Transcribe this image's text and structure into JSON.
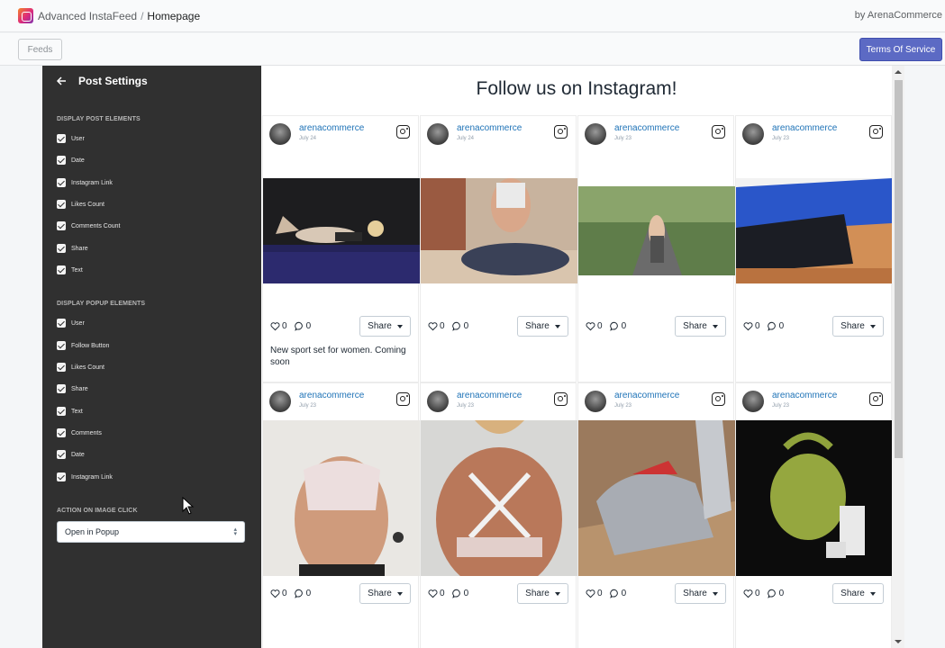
{
  "header": {
    "app_name": "Advanced InstaFeed",
    "separator": "/",
    "page": "Homepage",
    "byline": "by ArenaCommerce"
  },
  "toolbar": {
    "feeds_label": "Feeds",
    "tos_label": "Terms Of Service"
  },
  "sidebar": {
    "title": "Post Settings",
    "post_section_title": "DISPLAY POST ELEMENTS",
    "post_elements": [
      "User",
      "Date",
      "Instagram Link",
      "Likes Count",
      "Comments Count",
      "Share",
      "Text"
    ],
    "popup_section_title": "DISPLAY POPUP ELEMENTS",
    "popup_elements": [
      "User",
      "Follow Button",
      "Likes Count",
      "Share",
      "Text",
      "Comments",
      "Date",
      "Instagram Link"
    ],
    "action_section_title": "ACTION ON IMAGE CLICK",
    "action_value": "Open in Popup"
  },
  "feed": {
    "title": "Follow us on Instagram!",
    "share_label": "Share",
    "posts": [
      {
        "user": "arenacommerce",
        "date": "July 24",
        "likes": "0",
        "comments": "0",
        "caption": "New sport set for women. Coming soon"
      },
      {
        "user": "arenacommerce",
        "date": "July 24",
        "likes": "0",
        "comments": "0",
        "caption": ""
      },
      {
        "user": "arenacommerce",
        "date": "July 23",
        "likes": "0",
        "comments": "0",
        "caption": ""
      },
      {
        "user": "arenacommerce",
        "date": "July 23",
        "likes": "0",
        "comments": "0",
        "caption": ""
      },
      {
        "user": "arenacommerce",
        "date": "July 23",
        "likes": "0",
        "comments": "0",
        "caption": ""
      },
      {
        "user": "arenacommerce",
        "date": "July 23",
        "likes": "0",
        "comments": "0",
        "caption": ""
      },
      {
        "user": "arenacommerce",
        "date": "July 23",
        "likes": "0",
        "comments": "0",
        "caption": ""
      },
      {
        "user": "arenacommerce",
        "date": "July 23",
        "likes": "0",
        "comments": "0",
        "caption": ""
      }
    ]
  },
  "colors": {
    "sidebar_bg": "#303030",
    "primary_button": "#5c6ac4",
    "username_link": "#1f73b7"
  }
}
